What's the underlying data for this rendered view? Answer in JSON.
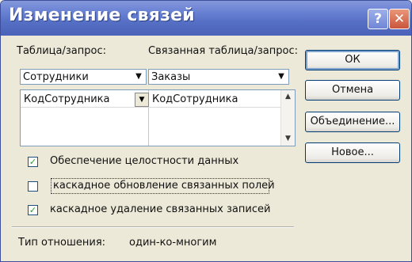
{
  "window": {
    "title": "Изменение связей"
  },
  "titlebar": {
    "help_glyph": "?",
    "close_glyph": "✕"
  },
  "tables": {
    "left_label": "Таблица/запрос:",
    "right_label": "Связанная таблица/запрос:",
    "left_value": "Сотрудники",
    "right_value": "Заказы"
  },
  "fields": {
    "left_field": "КодСотрудника",
    "right_field": "КодСотрудника"
  },
  "options": {
    "integrity": {
      "label": "Обеспечение целостности данных",
      "checked": true
    },
    "cascade_update": {
      "label": "каскадное обновление связанных полей",
      "checked": false
    },
    "cascade_delete": {
      "label": "каскадное удаление связанных записей",
      "checked": true
    }
  },
  "relationship": {
    "label": "Тип отношения:",
    "value": "один-ко-многим"
  },
  "buttons": {
    "ok": "ОК",
    "cancel": "Отмена",
    "join": "Объединение...",
    "new": "Новое..."
  },
  "icons": {
    "dropdown": "chevron-down-icon",
    "scroll_up": "scroll-up-icon",
    "scroll_down": "scroll-down-icon"
  },
  "colors": {
    "titlebar": "#5670c6",
    "dialog_bg": "#ece9d8",
    "check_mark": "#21a121"
  }
}
